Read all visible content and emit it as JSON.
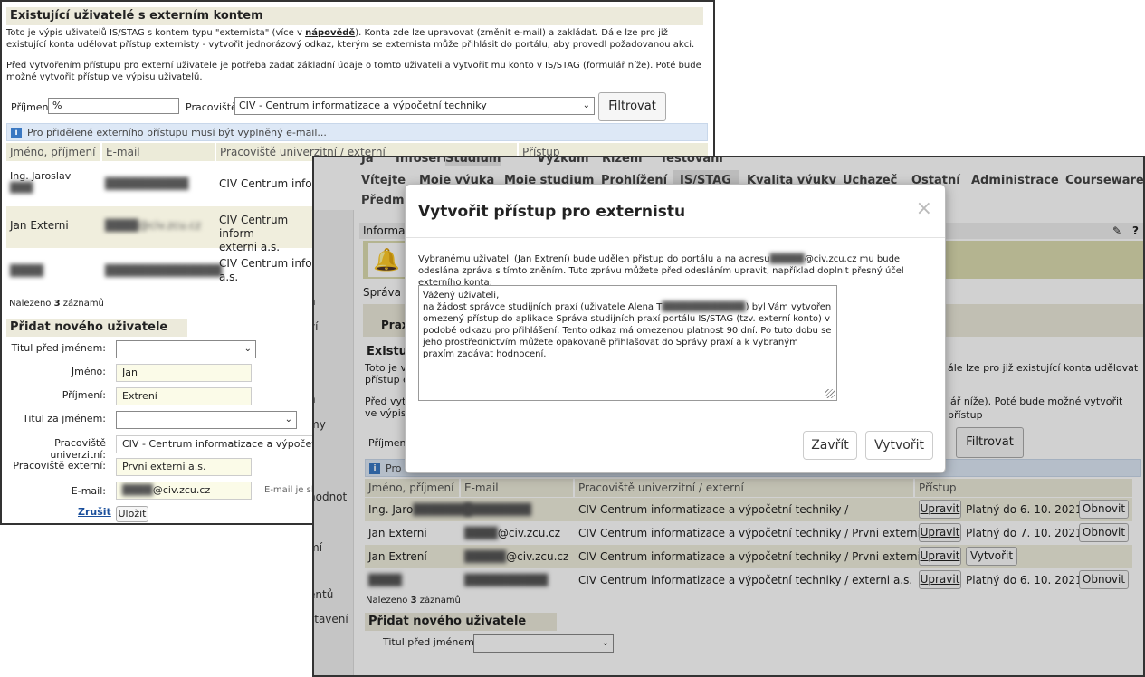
{
  "left": {
    "title": "Existující uživatelé s externím kontem",
    "p1a": "Toto je výpis uživatelů IS/STAG s kontem typu \"externista\" (více v ",
    "p1link": "nápovědě",
    "p1b": "). Konta zde lze upravovat (změnit e-mail) a zakládat. Dále lze pro již existující konta udělovat přístup externisty - vytvořit jednorázový odkaz, kterým se externista může přihlásit do portálu, aby provedl požadovanou akci.",
    "p2": "Před vytvořením přístupu pro externí uživatele je potřeba zadat základní údaje o tomto uživateli a vytvořit mu konto v IS/STAG (formulář níže). Poté bude možné vytvořit přístup ve výpisu uživatelů.",
    "prijmeni_label": "Příjmení",
    "prijmeni_value": "%",
    "pracoviste_label": "Pracoviště",
    "pracoviste_value": "CIV - Centrum informatizace a výpočetní techniky",
    "filtr": "Filtrovat",
    "info": "Pro přidělené externího přístupu musí být vyplněný e-mail...",
    "headers": [
      "Jméno, příjmení",
      "E-mail",
      "Pracoviště univerzitní / externí",
      "Přístup"
    ],
    "rows": [
      {
        "name": "Ing. Jaroslav",
        "name2": "███",
        "email": "██████████",
        "prac": "CIV Centrum inform"
      },
      {
        "name": "Jan Externi",
        "email": "████@civ.zcu.cz",
        "prac": "CIV Centrum inform",
        "prac2": "externi a.s."
      },
      {
        "name": "████",
        "email": "██████████████",
        "prac": "CIV Centrum inform",
        "prac2": "a.s."
      }
    ],
    "found_pre": "Nalezeno ",
    "found_n": "3",
    "found_post": " záznamů",
    "add_title": "Přidat nového uživatele",
    "f_titul_pred": "Titul před jménem:",
    "f_jmeno": "Jméno:",
    "v_jmeno": "Jan",
    "f_prijmeni": "Příjmení:",
    "v_prijmeni": "Extrení",
    "f_titul_za": "Titul za jménem:",
    "f_prac_u": "Pracoviště univerzitní:",
    "v_prac_u": "CIV - Centrum informatizace a výpočetní te",
    "f_prac_e": "Pracoviště externí:",
    "v_prac_e": "Prvni externi a.s.",
    "f_email": "E-mail:",
    "v_email_user": "████",
    "v_email_dom": "@civ.zcu.cz",
    "email_note": "E-mail je sl",
    "zrusit": "Zrušit",
    "ulozit": "Uložit",
    "side": [
      "n",
      "ví",
      "n",
      "my",
      "hodnot"
    ]
  },
  "right": {
    "top_nav": [
      "Já",
      "Infoservis",
      "Studium",
      "Výzkum",
      "Řízení",
      "Testování"
    ],
    "nav": [
      "Vítejte",
      "Moje výuka",
      "Moje studium",
      "Prohlížení",
      "IS/STAG",
      "Kvalita výuky",
      "Uchazeč",
      "Ostatní",
      "Administrace",
      "Courseware"
    ],
    "nav2": "Předmě",
    "informace": "Informac",
    "sprava": "Správa p",
    "praxe": "Prax",
    "existuj": "Existuj",
    "tjv": "Toto je v",
    "px": "přístup ex",
    "pv": "Před vytv",
    "vv": "ve výpisu",
    "right_txt1": "ále lze pro již existující konta udělovat",
    "right_txt2": "lář níže). Poté bude možné vytvořit přístup",
    "prijmeni": "Příjmení",
    "filtr": "Filtrovat",
    "pro": "Pro",
    "side": [
      "mí",
      "entů",
      "stavení"
    ],
    "headers": [
      "Jméno, příjmení",
      "E-mail",
      "Pracoviště univerzitní / externí",
      "Přístup"
    ],
    "rows": [
      {
        "name": "Ing. Jaro",
        "nameb": "███████",
        "email": "████████",
        "prac": "CIV Centrum informatizace a výpočetní techniky / -",
        "btn1": "Upravit",
        "platny": "Platný do 6. 10. 2021",
        "btn2": "Obnovit"
      },
      {
        "name": "Jan Externi",
        "emailb": "████",
        "email": "@civ.zcu.cz",
        "prac": "CIV Centrum informatizace a výpočetní techniky / Prvni externi a.s.",
        "btn1": "Upravit",
        "platny": "Platný do 7. 10. 2021",
        "btn2": "Obnovit"
      },
      {
        "name": "Jan Extrení",
        "emailb": "█████",
        "email": "@civ.zcu.cz",
        "prac": "CIV Centrum informatizace a výpočetní techniky / Prvni externi a.s.",
        "btn1": "Upravit",
        "platny": "",
        "btn2": "Vytvořit"
      },
      {
        "name": "████",
        "email": "██████████",
        "prac": "CIV Centrum informatizace a výpočetní techniky / externi a.s.",
        "btn1": "Upravit",
        "platny": "Platný do 6. 10. 2021",
        "btn2": "Obnovit"
      }
    ],
    "found_pre": "Nalezeno ",
    "found_n": "3",
    "found_post": " záznamů",
    "add_title": "Přidat nového uživatele",
    "f_titul_pred": "Titul před jménem:"
  },
  "modal": {
    "title": "Vytvořit přístup pro externistu",
    "close": "×",
    "intro_a": "Vybranému uživateli (Jan Extrení) bude udělen přístup do portálu a na adresu",
    "intro_blur": "█████",
    "intro_b": "@civ.zcu.cz mu bude odeslána zpráva s tímto zněním. Tuto zprávu můžete před odesláním upravit, například doplnit přesný účel externího konta:",
    "msg_1": "Vážený uživateli,\nna žádost správce studijních praxí (uživatele Alena T",
    "msg_blur": "████████████",
    "msg_2": ") byl Vám vytvořen omezený přístup do aplikace Správa studijních praxí portálu IS/STAG (tzv. externí konto) v podobě odkazu pro přihlášení. Tento odkaz má omezenou platnost 90 dní. Po tuto dobu se jeho prostřednictvím můžete opakovaně přihlašovat do Správy praxí a k vybraným praxím zadávat hodnocení.",
    "zavrit": "Zavřít",
    "vytvorit": "Vytvořit"
  }
}
